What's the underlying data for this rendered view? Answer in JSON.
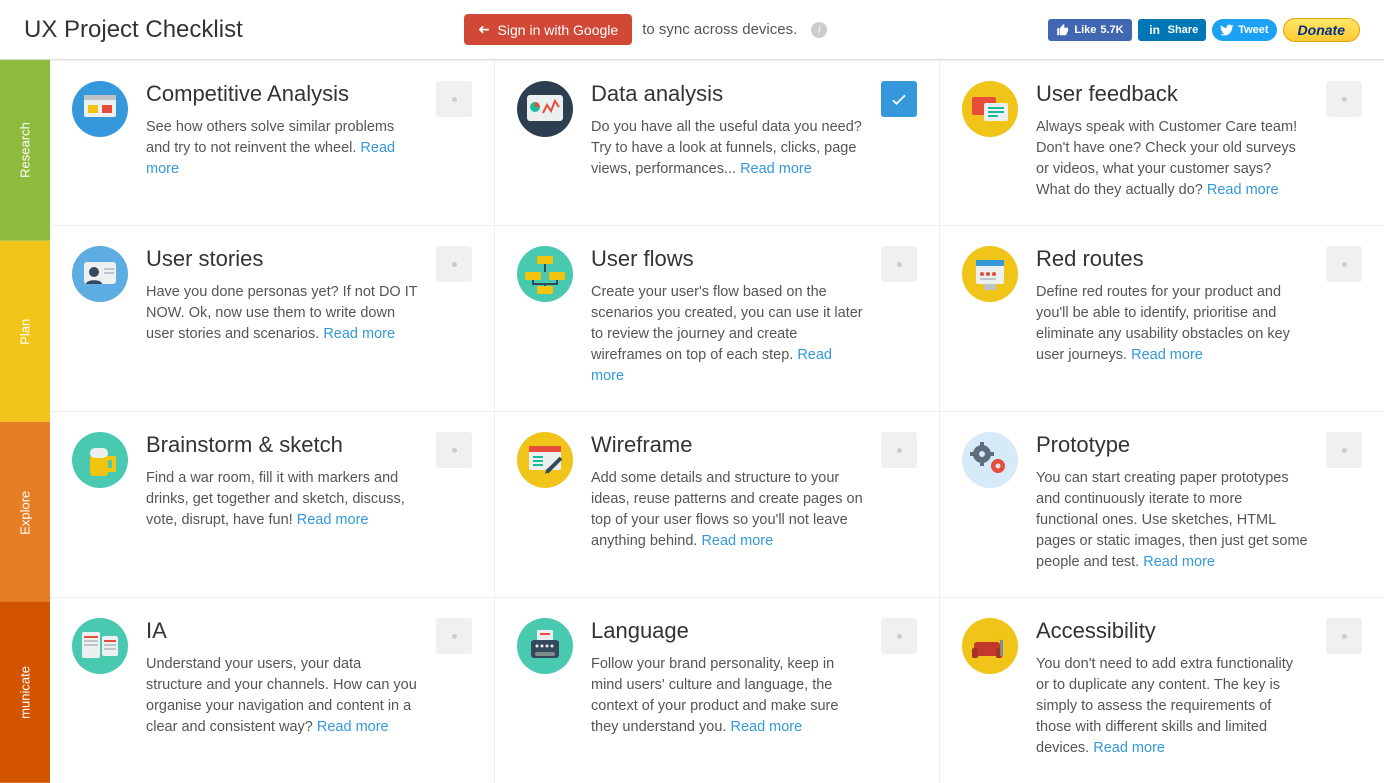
{
  "header": {
    "title": "UX Project Checklist",
    "google_signin": "Sign in with Google",
    "sync_text": "to sync across devices.",
    "fb_like": "Like",
    "fb_count": "5.7K",
    "li_share": "Share",
    "tw_tweet": "Tweet",
    "donate": "Donate"
  },
  "sidebar": [
    {
      "label": "Research",
      "color": "#8dbb3d"
    },
    {
      "label": "Plan",
      "color": "#f0c419"
    },
    {
      "label": "Explore",
      "color": "#e57e25"
    },
    {
      "label": "municate",
      "color": "#d35400"
    }
  ],
  "read_more": "Read more",
  "cards": [
    {
      "title": "Competitive Analysis",
      "desc": "See how others solve similar problems and try to not reinvent the wheel.",
      "checked": false,
      "icon": "screens"
    },
    {
      "title": "Data analysis",
      "desc": "Do you have all the useful data you need? Try to have a look at funnels, clicks, page views, performances...",
      "checked": true,
      "icon": "chart"
    },
    {
      "title": "User feedback",
      "desc": "Always speak with Customer Care team! Don't have one? Check your old surveys or videos, what your customer says? What do they actually do?",
      "checked": false,
      "icon": "feedback"
    },
    {
      "title": "User stories",
      "desc": "Have you done personas yet? If not DO IT NOW. Ok, now use them to write down user stories and scenarios.",
      "checked": false,
      "icon": "persona"
    },
    {
      "title": "User flows",
      "desc": "Create your user's flow based on the scenarios you created, you can use it later to review the journey and create wireframes on top of each step.",
      "checked": false,
      "icon": "flows"
    },
    {
      "title": "Red routes",
      "desc": "Define red routes for your product and you'll be able to identify, prioritise and eliminate any usability obstacles on key user journeys.",
      "checked": false,
      "icon": "routes"
    },
    {
      "title": "Brainstorm & sketch",
      "desc": "Find a war room, fill it with markers and drinks, get together and sketch, discuss, vote, disrupt, have fun!",
      "checked": false,
      "icon": "beer"
    },
    {
      "title": "Wireframe",
      "desc": "Add some details and structure to your ideas, reuse patterns and create pages on top of your user flows so you'll not leave anything behind.",
      "checked": false,
      "icon": "wireframe"
    },
    {
      "title": "Prototype",
      "desc": "You can start creating paper prototypes and continuously iterate to more functional ones. Use sketches, HTML pages or static images, then just get some people and test.",
      "checked": false,
      "icon": "gears"
    },
    {
      "title": "IA",
      "desc": "Understand your users, your data structure and your channels. How can you organise your navigation and content in a clear and consistent way?",
      "checked": false,
      "icon": "ia"
    },
    {
      "title": "Language",
      "desc": "Follow your brand personality, keep in mind users' culture and language, the context of your product and make sure they understand you.",
      "checked": false,
      "icon": "typewriter"
    },
    {
      "title": "Accessibility",
      "desc": "You don't need to add extra functionality or to duplicate any content. The key is simply to assess the requirements of those with different skills and limited devices.",
      "checked": false,
      "icon": "sofa"
    }
  ]
}
